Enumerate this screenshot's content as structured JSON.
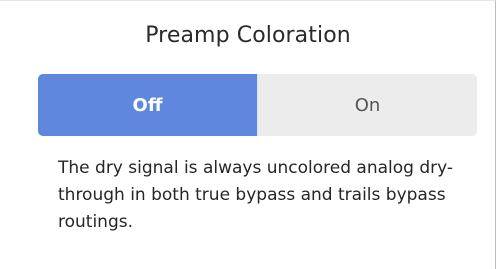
{
  "panel": {
    "title": "Preamp Coloration",
    "options": [
      {
        "label": "Off",
        "selected": true
      },
      {
        "label": "On",
        "selected": false
      }
    ],
    "description": "The dry signal is always uncolored analog dry-through in both true bypass and trails bypass routings.",
    "colors": {
      "selected_bg": "#5f87de",
      "unselected_bg": "#ececec"
    }
  }
}
